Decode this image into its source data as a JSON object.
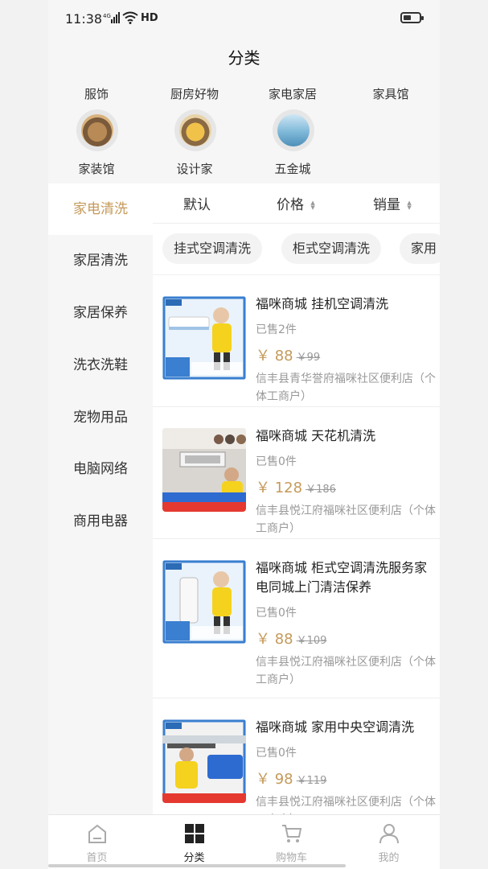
{
  "status": {
    "time": "11:38",
    "network": "4G",
    "hd": "HD"
  },
  "header": {
    "title": "分类"
  },
  "top_categories": [
    {
      "label": "服饰"
    },
    {
      "label": "厨房好物"
    },
    {
      "label": "家电家居"
    },
    {
      "label": "家具馆"
    }
  ],
  "icon_categories": [
    {
      "label": "家装馆",
      "icon": "house-decor-icon"
    },
    {
      "label": "设计家",
      "icon": "design-room-icon"
    },
    {
      "label": "五金城",
      "icon": "hardware-store-icon"
    }
  ],
  "sidebar": {
    "items": [
      {
        "label": "家电清洗",
        "active": true
      },
      {
        "label": "家居清洗"
      },
      {
        "label": "家居保养"
      },
      {
        "label": "洗衣洗鞋"
      },
      {
        "label": "宠物用品"
      },
      {
        "label": "电脑网络"
      },
      {
        "label": "商用电器"
      }
    ]
  },
  "sort": {
    "default": "默认",
    "price": "价格",
    "sales": "销量"
  },
  "chips": [
    "挂式空调清洗",
    "柜式空调清洗",
    "家用"
  ],
  "products": [
    {
      "title": "福咪商城 挂机空调清洗",
      "sold": "已售2件",
      "price": "￥ 88",
      "old_price": "￥99",
      "store": "信丰县青华誉府福咪社区便利店（个体工商户）"
    },
    {
      "title": "福咪商城 天花机清洗",
      "sold": "已售0件",
      "price": "￥ 128",
      "old_price": "￥186",
      "store": "信丰县悦江府福咪社区便利店（个体工商户）"
    },
    {
      "title": "福咪商城 柜式空调清洗服务家电同城上门清洁保养",
      "sold": "已售0件",
      "price": "￥ 88",
      "old_price": "￥109",
      "store": "信丰县悦江府福咪社区便利店（个体工商户）"
    },
    {
      "title": "福咪商城 家用中央空调清洗",
      "sold": "已售0件",
      "price": "￥ 98",
      "old_price": "￥119",
      "store": "信丰县悦江府福咪社区便利店（个体工商户）"
    }
  ],
  "tabbar": [
    {
      "label": "首页",
      "icon": "home-icon"
    },
    {
      "label": "分类",
      "icon": "category-grid-icon",
      "active": true
    },
    {
      "label": "购物车",
      "icon": "cart-icon"
    },
    {
      "label": "我的",
      "icon": "profile-icon"
    }
  ],
  "colors": {
    "accent": "#c59a5a",
    "text": "#222222",
    "muted": "#999999",
    "background": "#f6f6f6"
  }
}
